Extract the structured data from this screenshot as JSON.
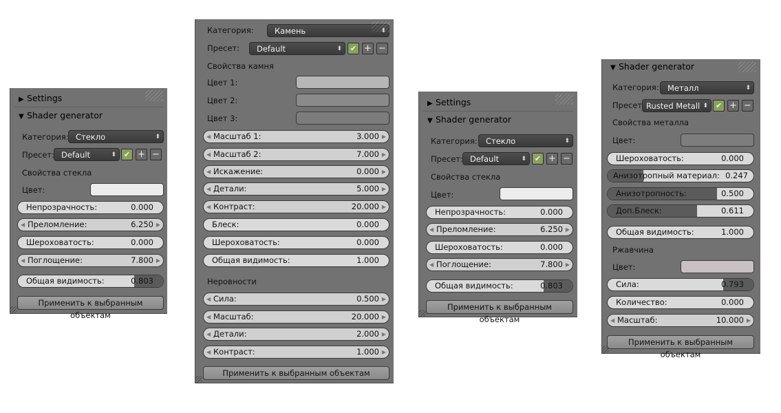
{
  "settings_label": "Settings",
  "shader_generator_label": "Shader generator",
  "category_label": "Категория:",
  "preset_label": "Пресет:",
  "color_label": "Цвет:",
  "apply_label": "Применить к выбранным объектам",
  "panel_glass": {
    "category": "Стекло",
    "preset": "Default",
    "section": "Свойства стекла",
    "color_value": "#ececec",
    "fields": [
      {
        "label": "Непрозрачность:",
        "value": "0.000",
        "fill": 0.0
      },
      {
        "label": "Преломление:",
        "value": "6.250"
      },
      {
        "label": "Шероховатость:",
        "value": "0.000",
        "fill": 0.0
      },
      {
        "label": "Поглощение:",
        "value": "7.800"
      },
      {
        "label": "Общая видимость:",
        "value": "0.803",
        "fill": 0.803
      }
    ]
  },
  "panel_stone": {
    "category": "Камень",
    "preset": "Default",
    "section": "Свойства камня",
    "color1_label": "Цвет 1:",
    "color2_label": "Цвет 2:",
    "color3_label": "Цвет 3:",
    "color1_value": "#b6b6b6",
    "color2_value": "#8a8a8a",
    "color3_value": "#7c7c7c",
    "fields": [
      {
        "label": "Масштаб 1:",
        "value": "3.000"
      },
      {
        "label": "Масштаб 2:",
        "value": "7.000"
      },
      {
        "label": "Искажение:",
        "value": "0.000"
      },
      {
        "label": "Детали:",
        "value": "5.000"
      },
      {
        "label": "Контраст:",
        "value": "20.000"
      },
      {
        "label": "Блеск:",
        "value": "0.000",
        "fill": 0.0
      },
      {
        "label": "Шероховатость:",
        "value": "0.000",
        "fill": 0.0
      },
      {
        "label": "Общая видимость:",
        "value": "1.000",
        "fill": 1.0
      }
    ],
    "bumps_section": "Неровности",
    "bumps": [
      {
        "label": "Сила:",
        "value": "0.500"
      },
      {
        "label": "Масштаб:",
        "value": "20.000"
      },
      {
        "label": "Детали:",
        "value": "2.000"
      },
      {
        "label": "Контраст:",
        "value": "1.000"
      }
    ]
  },
  "panel_glass2": {
    "category": "Стекло",
    "preset": "Default",
    "section": "Свойства стекла",
    "color_value": "#ececec",
    "fields": [
      {
        "label": "Непрозрачность:",
        "value": "0.000",
        "fill": 0.0
      },
      {
        "label": "Преломление:",
        "value": "6.250"
      },
      {
        "label": "Шероховатость:",
        "value": "0.000",
        "fill": 0.0
      },
      {
        "label": "Поглощение:",
        "value": "7.800"
      },
      {
        "label": "Общая видимость:",
        "value": "0.803",
        "fill": 0.803
      }
    ]
  },
  "panel_metal": {
    "category": "Металл",
    "preset": "Rusted Metall",
    "section": "Свойства металла",
    "color_value": "#7d7d7d",
    "fields": [
      {
        "label": "Шероховатость:",
        "value": "0.000",
        "fill": 0.0
      },
      {
        "label": "Анизотропный материал:",
        "value": "0.247",
        "fill": 0.247
      },
      {
        "label": "Анизотропность:",
        "value": "0.500",
        "fill": 0.5
      },
      {
        "label": "Доп.Блеск:",
        "value": "0.611",
        "fill": 0.611
      },
      {
        "label": "Общая видимость:",
        "value": "1.000",
        "fill": 1.0
      }
    ],
    "rust_section": "Ржавчина",
    "rust_color_value": "#c9c0c4",
    "rust": [
      {
        "label": "Сила:",
        "value": "0.793",
        "fill": 0.793
      },
      {
        "label": "Количество:",
        "value": "0.000",
        "fill": 0.0
      },
      {
        "label": "Масштаб:",
        "value": "10.000"
      }
    ]
  }
}
